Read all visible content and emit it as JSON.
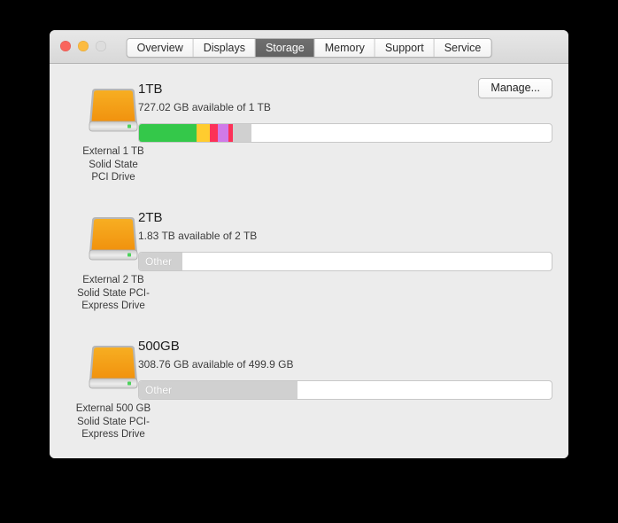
{
  "window": {
    "traffic_lights": [
      {
        "name": "close",
        "label": "Close",
        "color": "#f9655d"
      },
      {
        "name": "minimize",
        "label": "Minimize",
        "color": "#fcbb40"
      },
      {
        "name": "zoom",
        "label": "Zoom",
        "color": "#dddddd"
      }
    ],
    "tabs": [
      {
        "label": "Overview",
        "active": false
      },
      {
        "label": "Displays",
        "active": false
      },
      {
        "label": "Storage",
        "active": true
      },
      {
        "label": "Memory",
        "active": false
      },
      {
        "label": "Support",
        "active": false
      },
      {
        "label": "Service",
        "active": false
      }
    ]
  },
  "colors": {
    "window_bg": "#ececec",
    "titlebar_top": "#e8e8e8",
    "titlebar_bottom": "#d8d8d8",
    "tab_active_bg": "#666666",
    "bar_track": "#ffffff",
    "bar_border": "#c8c8c8",
    "seg_apps_green": "#34c84a",
    "seg_docs_yellow": "#ffcc2f",
    "seg_red": "#fc3158",
    "seg_purple": "#d07ae8",
    "seg_other_gray": "#d0d0d0",
    "icon_body_top": "#f7a81b",
    "icon_body_bottom": "#f59a14",
    "icon_bezel": "#b9b9b9",
    "icon_led": "#4cd25b"
  },
  "drives": [
    {
      "title": "1TB",
      "availability": "727.02 GB available of 1 TB",
      "caption": "External 1 TB\nSolid State\nPCI Drive",
      "manage_label": "Manage...",
      "has_manage_button": true,
      "segments": [
        {
          "name": "apps",
          "color": "#34c84a",
          "percent": 14.0,
          "label": ""
        },
        {
          "name": "documents",
          "color": "#ffcc2f",
          "percent": 3.2,
          "label": ""
        },
        {
          "name": "system",
          "color": "#fc3158",
          "percent": 2.0,
          "label": ""
        },
        {
          "name": "photos",
          "color": "#d07ae8",
          "percent": 2.4,
          "label": ""
        },
        {
          "name": "mail",
          "color": "#fc3158",
          "percent": 1.1,
          "label": ""
        },
        {
          "name": "other",
          "color": "#d0d0d0",
          "percent": 4.6,
          "label": ""
        }
      ]
    },
    {
      "title": "2TB",
      "availability": "1.83 TB available of 2 TB",
      "caption": "External 2 TB\nSolid State PCI-\nExpress Drive",
      "manage_label": "",
      "has_manage_button": false,
      "segments": [
        {
          "name": "other",
          "color": "#d0d0d0",
          "percent": 10.6,
          "label": "Other"
        }
      ]
    },
    {
      "title": "500GB",
      "availability": "308.76 GB available of 499.9 GB",
      "caption": "External 500 GB\nSolid State PCI-\nExpress Drive",
      "manage_label": "",
      "has_manage_button": false,
      "segments": [
        {
          "name": "other",
          "color": "#d0d0d0",
          "percent": 38.5,
          "label": "Other"
        }
      ]
    }
  ]
}
